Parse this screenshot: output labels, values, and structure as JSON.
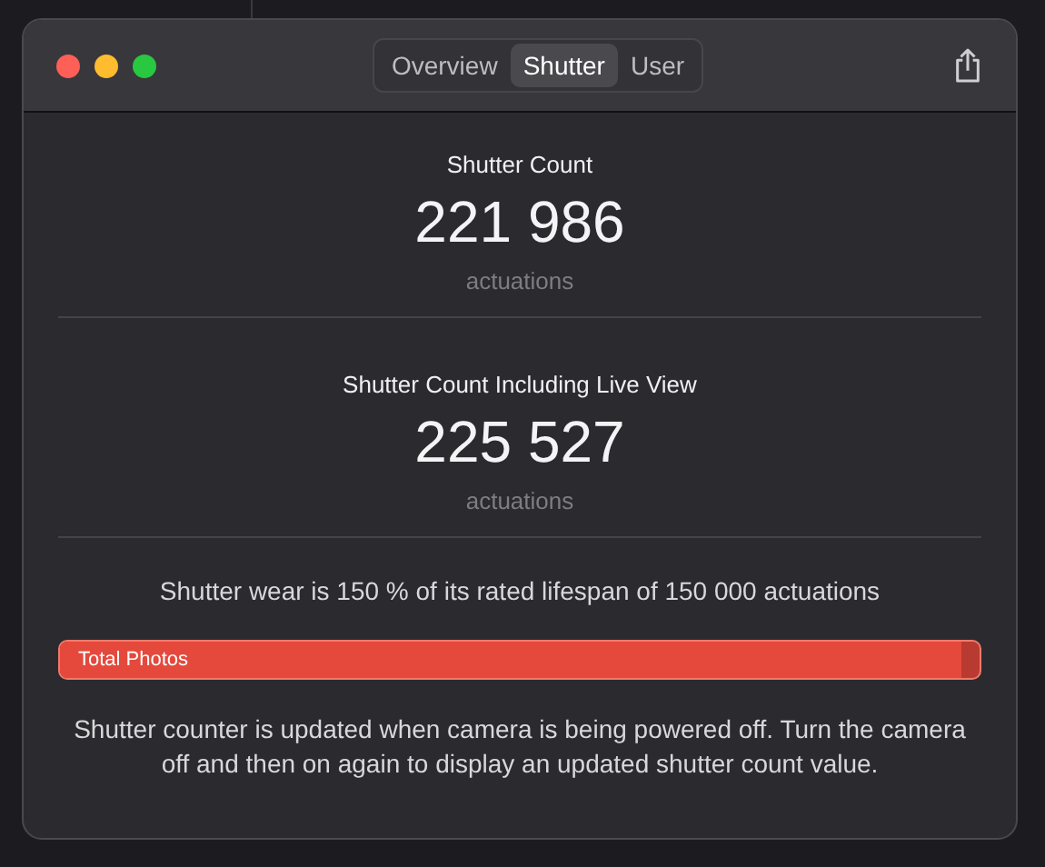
{
  "window": {
    "tabs": [
      {
        "label": "Overview",
        "selected": false
      },
      {
        "label": "Shutter",
        "selected": true
      },
      {
        "label": "User",
        "selected": false
      }
    ]
  },
  "counts": [
    {
      "title": "Shutter Count",
      "value": "221 986",
      "unit": "actuations"
    },
    {
      "title": "Shutter Count Including Live View",
      "value": "225 527",
      "unit": "actuations"
    }
  ],
  "wear": {
    "text": "Shutter wear is 150 % of its rated lifespan of 150 000 actuations",
    "bar_label": "Total Photos",
    "level": 0.98
  },
  "note": "Shutter counter is updated when camera is being powered off. Turn the camera off and then on again to display an updated shutter count value."
}
